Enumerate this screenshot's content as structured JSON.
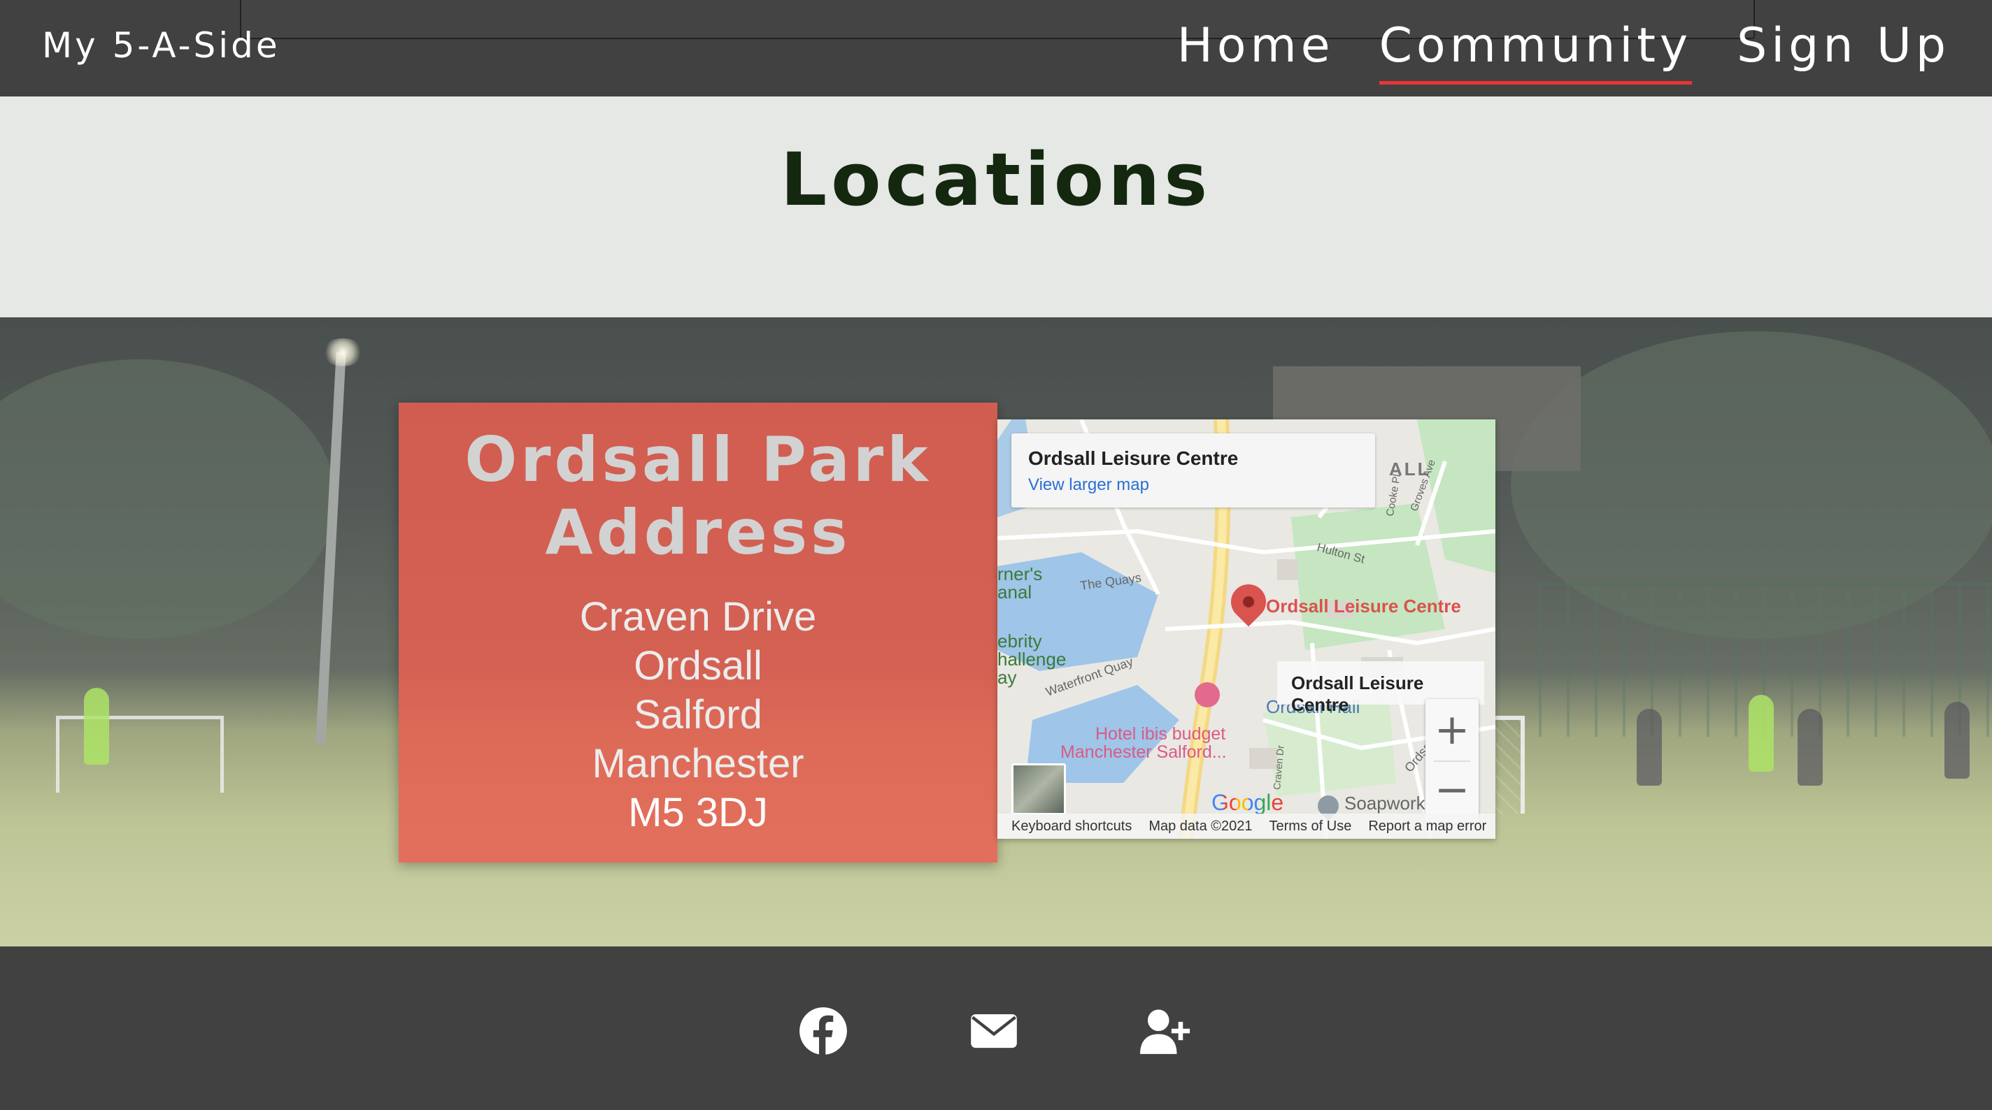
{
  "nav": {
    "brand": "My 5-A-Side",
    "links": [
      {
        "label": "Home",
        "active": false
      },
      {
        "label": "Community",
        "active": true
      },
      {
        "label": "Sign Up",
        "active": false
      }
    ],
    "accent_color": "#e33333"
  },
  "page": {
    "title": "Locations"
  },
  "location_card": {
    "title": "Ordsall Park Address",
    "address_lines": [
      "Craven Drive",
      "Ordsall",
      "Salford",
      "Manchester"
    ],
    "postcode": "M5 3DJ"
  },
  "map": {
    "info_title": "Ordsall Leisure Centre",
    "info_link": "View larger map",
    "pin_label": "Ordsall Leisure Centre",
    "hover_label": "Ordsall Leisure Centre",
    "places": {
      "hotel": "Hotel ibis budget",
      "hotel_sub": "Manchester Salford...",
      "ordsall_hall": "Ordsall Hall",
      "soapworks": "Soapworks",
      "the_quays": "The Quays",
      "waterfront_quay": "Waterfront Quay",
      "hulton_st": "Hulton St",
      "district": "ALL",
      "canal_top": "rner's",
      "canal_bottom": "anal",
      "celebrity_top": "ebrity",
      "celebrity_mid": "hallenge",
      "celebrity_bot": "ay",
      "groves_ave": "Groves Ave",
      "cooke_pl": "Cooke Pl",
      "craven_dr": "Craven Dr",
      "ordsall_rd": "Ordsall"
    },
    "zoom_in": "+",
    "zoom_out": "−",
    "google_logo": "Google",
    "footer": [
      "Keyboard shortcuts",
      "Map data ©2021",
      "Terms of Use",
      "Report a map error"
    ]
  },
  "footer": {
    "icons": [
      "facebook-icon",
      "mail-icon",
      "add-user-icon"
    ]
  }
}
